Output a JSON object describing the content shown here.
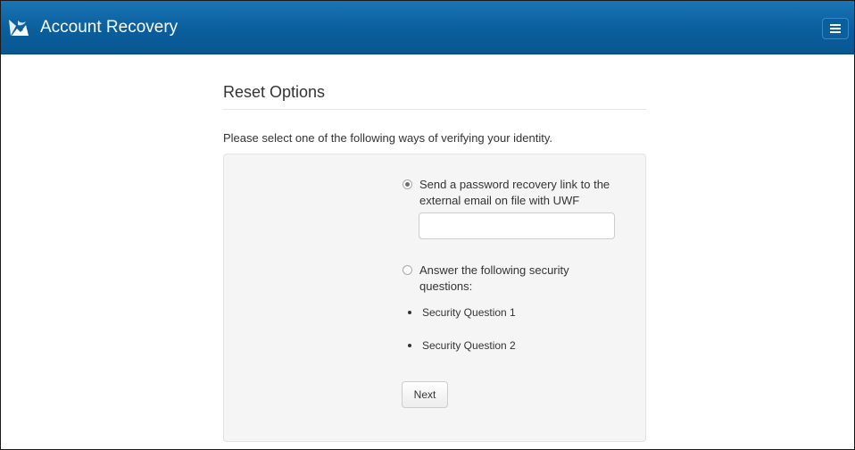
{
  "header": {
    "title": "Account Recovery",
    "logo_icon": "argo-logo-icon",
    "menu_icon": "hamburger-menu-icon",
    "background_color": "#0a5e9c"
  },
  "main": {
    "heading": "Reset Options",
    "instructions": "Please select one of the following ways of verifying your identity."
  },
  "options": {
    "email": {
      "line1": "Send a password recovery link to the",
      "line2": "external email on file with UWF",
      "selected": true,
      "input_value": "",
      "input_placeholder": ""
    },
    "questions": {
      "line1": "Answer the following security",
      "line2": "questions:",
      "selected": false,
      "items": [
        "Security Question 1",
        "Security Question 2"
      ]
    }
  },
  "actions": {
    "next_label": "Next"
  }
}
